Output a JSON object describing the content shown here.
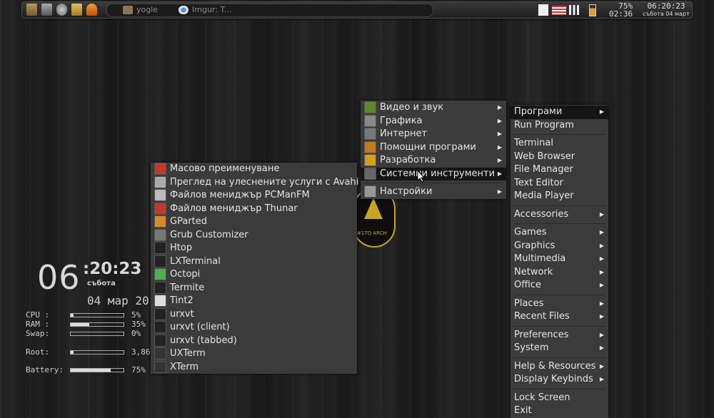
{
  "panel": {
    "tasks": [
      {
        "icon": "folder-icon",
        "label": "yogle"
      },
      {
        "icon": "chrome-icon",
        "label": "Imgur: T..."
      }
    ],
    "battery": "75%",
    "uptime": "02:36",
    "time": "06:20:23",
    "date": "събота 04 март"
  },
  "conky": {
    "hour": "06",
    "minsec": ":20:23",
    "day": "събота",
    "date": "04 мар 20",
    "stats": [
      {
        "label": "CPU :",
        "value": "5%",
        "fill": 0.05
      },
      {
        "label": "RAM :",
        "value": "35%",
        "fill": 0.35
      },
      {
        "label": "Swap:",
        "value": "0%",
        "fill": 0.0
      },
      {
        "label": "Root:",
        "value": "3,86",
        "fill": 0.05
      },
      {
        "label": "Battery:",
        "value": "75%",
        "fill": 0.75
      }
    ]
  },
  "main_menu": {
    "items": [
      {
        "label": "Програми",
        "arrow": "▶",
        "active": true
      },
      {
        "label": "Run Program"
      },
      {
        "sep": true
      },
      {
        "label": "Terminal"
      },
      {
        "label": "Web Browser"
      },
      {
        "label": "File Manager"
      },
      {
        "label": "Text Editor"
      },
      {
        "label": "Media Player"
      },
      {
        "sep": true
      },
      {
        "label": "Accessories",
        "arrow": "▶"
      },
      {
        "sep": true
      },
      {
        "label": "Games",
        "arrow": "▶"
      },
      {
        "label": "Graphics",
        "arrow": "▶"
      },
      {
        "label": "Multimedia",
        "arrow": "▶"
      },
      {
        "label": "Network",
        "arrow": "▶"
      },
      {
        "label": "Office",
        "arrow": "▶"
      },
      {
        "sep": true
      },
      {
        "label": "Places",
        "arrow": "▶"
      },
      {
        "label": "Recent Files",
        "arrow": "▶"
      },
      {
        "sep": true
      },
      {
        "label": "Preferences",
        "arrow": "▶"
      },
      {
        "label": "System",
        "arrow": "▶"
      },
      {
        "sep": true
      },
      {
        "label": "Help & Resources",
        "arrow": "▶"
      },
      {
        "label": "Display Keybinds",
        "arrow": "▶"
      },
      {
        "sep": true
      },
      {
        "label": "Lock Screen"
      },
      {
        "label": "Exit"
      }
    ]
  },
  "programs_menu": {
    "items": [
      {
        "label": "Видео и звук",
        "arrow": "▶",
        "icon": "video-audio-icon",
        "color": "#5a8a2a"
      },
      {
        "label": "Графика",
        "arrow": "▶",
        "icon": "graphics-icon",
        "color": "#888888"
      },
      {
        "label": "Интернет",
        "arrow": "▶",
        "icon": "internet-icon",
        "color": "#777777"
      },
      {
        "label": "Помощни програми",
        "arrow": "▶",
        "icon": "utilities-icon",
        "color": "#c07a20"
      },
      {
        "label": "Разработка",
        "arrow": "▶",
        "icon": "development-icon",
        "color": "#d4a017"
      },
      {
        "label": "Системни инструменти",
        "arrow": "▶",
        "icon": "system-tools-icon",
        "color": "#666666",
        "active": true
      },
      {
        "sep": true
      },
      {
        "label": "Настройки",
        "arrow": "▶",
        "icon": "settings-icon",
        "color": "#999999"
      }
    ]
  },
  "system_menu": {
    "items": [
      {
        "label": "Масово преименуване",
        "icon": "bulk-rename-icon",
        "color": "#c0392b"
      },
      {
        "label": "Преглед на улеснените услуги с Avahi",
        "icon": "avahi-icon",
        "color": "#aaaaaa"
      },
      {
        "label": "Файлов мениджър PCManFM",
        "icon": "pcmanfm-icon",
        "color": "#bbbbbb"
      },
      {
        "label": "Файлов мениджър Thunar",
        "icon": "thunar-icon",
        "color": "#c0392b"
      },
      {
        "label": "GParted",
        "icon": "gparted-icon",
        "color": "#d88a2a"
      },
      {
        "label": "Grub Customizer",
        "icon": "grub-icon",
        "color": "#777777"
      },
      {
        "label": "Htop",
        "icon": "htop-icon",
        "color": "#222222"
      },
      {
        "label": "LXTerminal",
        "icon": "lxterminal-icon",
        "color": "#222222"
      },
      {
        "label": "Octopi",
        "icon": "octopi-icon",
        "color": "#4caf50"
      },
      {
        "label": "Termite",
        "icon": "termite-icon",
        "color": "#222222"
      },
      {
        "label": "Tint2",
        "icon": "tint2-icon",
        "color": "#dddddd"
      },
      {
        "label": "urxvt",
        "icon": "urxvt-icon",
        "color": "#222222"
      },
      {
        "label": "urxvt (client)",
        "icon": "urxvt-icon",
        "color": "#222222"
      },
      {
        "label": "urxvt (tabbed)",
        "icon": "urxvt-icon",
        "color": "#222222"
      },
      {
        "label": "UXTerm",
        "icon": "xterm-icon",
        "color": "#333333"
      },
      {
        "label": "XTerm",
        "icon": "xterm-icon",
        "color": "#333333"
      }
    ]
  }
}
